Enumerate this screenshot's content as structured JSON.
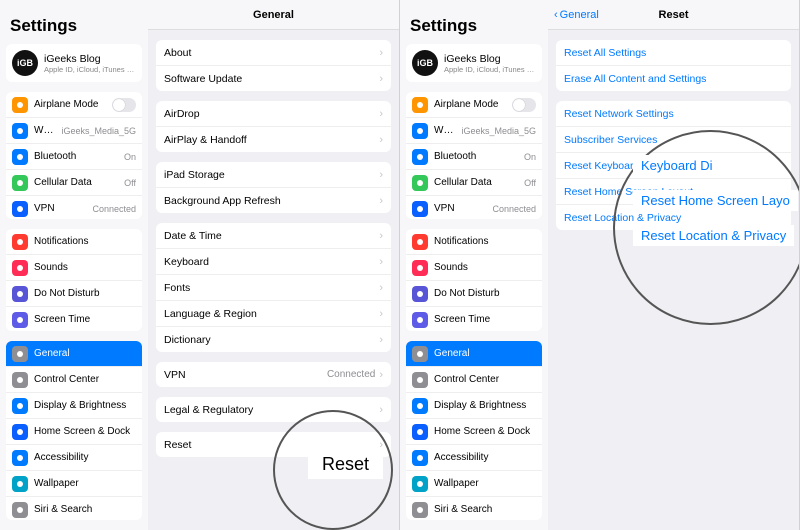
{
  "left": {
    "sidebar": {
      "title": "Settings",
      "profile": {
        "name": "iGeeks Blog",
        "sub": "Apple ID, iCloud, iTunes & App St…",
        "avatar": "iGB"
      },
      "group1": [
        {
          "icon": "airplane-icon",
          "color": "ic-orange",
          "label": "Airplane Mode",
          "value": "",
          "switch": true
        },
        {
          "icon": "wifi-icon",
          "color": "ic-blue",
          "label": "Wi-Fi",
          "value": "iGeeks_Media_5G"
        },
        {
          "icon": "bluetooth-icon",
          "color": "ic-blue",
          "label": "Bluetooth",
          "value": "On"
        },
        {
          "icon": "cellular-icon",
          "color": "ic-green",
          "label": "Cellular Data",
          "value": "Off"
        },
        {
          "icon": "vpn-icon",
          "color": "ic-darkblue",
          "label": "VPN",
          "value": "Connected"
        }
      ],
      "group2": [
        {
          "icon": "notifications-icon",
          "color": "ic-red",
          "label": "Notifications"
        },
        {
          "icon": "sounds-icon",
          "color": "ic-pink",
          "label": "Sounds"
        },
        {
          "icon": "dnd-icon",
          "color": "ic-purple",
          "label": "Do Not Disturb"
        },
        {
          "icon": "screentime-icon",
          "color": "ic-indigo",
          "label": "Screen Time"
        }
      ],
      "group3": [
        {
          "icon": "general-icon",
          "color": "ic-gray",
          "label": "General",
          "selected": true
        },
        {
          "icon": "controlcenter-icon",
          "color": "ic-gray",
          "label": "Control Center"
        },
        {
          "icon": "display-icon",
          "color": "ic-blue",
          "label": "Display & Brightness"
        },
        {
          "icon": "homescreen-icon",
          "color": "ic-darkblue",
          "label": "Home Screen & Dock"
        },
        {
          "icon": "accessibility-icon",
          "color": "ic-blue",
          "label": "Accessibility"
        },
        {
          "icon": "wallpaper-icon",
          "color": "ic-teal",
          "label": "Wallpaper"
        },
        {
          "icon": "siri-icon",
          "color": "ic-gray",
          "label": "Siri & Search"
        }
      ]
    },
    "detail": {
      "nav_title": "General",
      "groups": [
        [
          {
            "label": "About"
          },
          {
            "label": "Software Update"
          }
        ],
        [
          {
            "label": "AirDrop"
          },
          {
            "label": "AirPlay & Handoff"
          }
        ],
        [
          {
            "label": "iPad Storage"
          },
          {
            "label": "Background App Refresh"
          }
        ],
        [
          {
            "label": "Date & Time"
          },
          {
            "label": "Keyboard"
          },
          {
            "label": "Fonts"
          },
          {
            "label": "Language & Region"
          },
          {
            "label": "Dictionary"
          }
        ],
        [
          {
            "label": "VPN",
            "value": "Connected"
          }
        ],
        [
          {
            "label": "Legal & Regulatory"
          }
        ],
        [
          {
            "label": "Reset"
          }
        ]
      ],
      "highlight_label": "Reset"
    }
  },
  "right": {
    "sidebar": {
      "title": "Settings",
      "profile": {
        "name": "iGeeks Blog",
        "sub": "Apple ID, iCloud, iTunes & App St…",
        "avatar": "iGB"
      },
      "group1": [
        {
          "icon": "airplane-icon",
          "color": "ic-orange",
          "label": "Airplane Mode",
          "value": "",
          "switch": true
        },
        {
          "icon": "wifi-icon",
          "color": "ic-blue",
          "label": "Wi-Fi",
          "value": "iGeeks_Media_5G"
        },
        {
          "icon": "bluetooth-icon",
          "color": "ic-blue",
          "label": "Bluetooth",
          "value": "On"
        },
        {
          "icon": "cellular-icon",
          "color": "ic-green",
          "label": "Cellular Data",
          "value": "Off"
        },
        {
          "icon": "vpn-icon",
          "color": "ic-darkblue",
          "label": "VPN",
          "value": "Connected"
        }
      ],
      "group2": [
        {
          "icon": "notifications-icon",
          "color": "ic-red",
          "label": "Notifications"
        },
        {
          "icon": "sounds-icon",
          "color": "ic-pink",
          "label": "Sounds"
        },
        {
          "icon": "dnd-icon",
          "color": "ic-purple",
          "label": "Do Not Disturb"
        },
        {
          "icon": "screentime-icon",
          "color": "ic-indigo",
          "label": "Screen Time"
        }
      ],
      "group3": [
        {
          "icon": "general-icon",
          "color": "ic-gray",
          "label": "General",
          "selected": true
        },
        {
          "icon": "controlcenter-icon",
          "color": "ic-gray",
          "label": "Control Center"
        },
        {
          "icon": "display-icon",
          "color": "ic-blue",
          "label": "Display & Brightness"
        },
        {
          "icon": "homescreen-icon",
          "color": "ic-darkblue",
          "label": "Home Screen & Dock"
        },
        {
          "icon": "accessibility-icon",
          "color": "ic-blue",
          "label": "Accessibility"
        },
        {
          "icon": "wallpaper-icon",
          "color": "ic-teal",
          "label": "Wallpaper"
        },
        {
          "icon": "siri-icon",
          "color": "ic-gray",
          "label": "Siri & Search"
        }
      ]
    },
    "detail": {
      "nav_back": "General",
      "nav_title": "Reset",
      "groups": [
        [
          {
            "label": "Reset All Settings",
            "link": true
          },
          {
            "label": "Erase All Content and Settings",
            "link": true
          }
        ],
        [
          {
            "label": "Reset Network Settings",
            "link": true
          },
          {
            "label": "Subscriber Services",
            "link": true
          },
          {
            "label": "Reset Keyboard Dictionary",
            "link": true
          },
          {
            "label": "Reset Home Screen Layout",
            "link": true
          },
          {
            "label": "Reset Location & Privacy",
            "link": true
          }
        ]
      ]
    }
  }
}
